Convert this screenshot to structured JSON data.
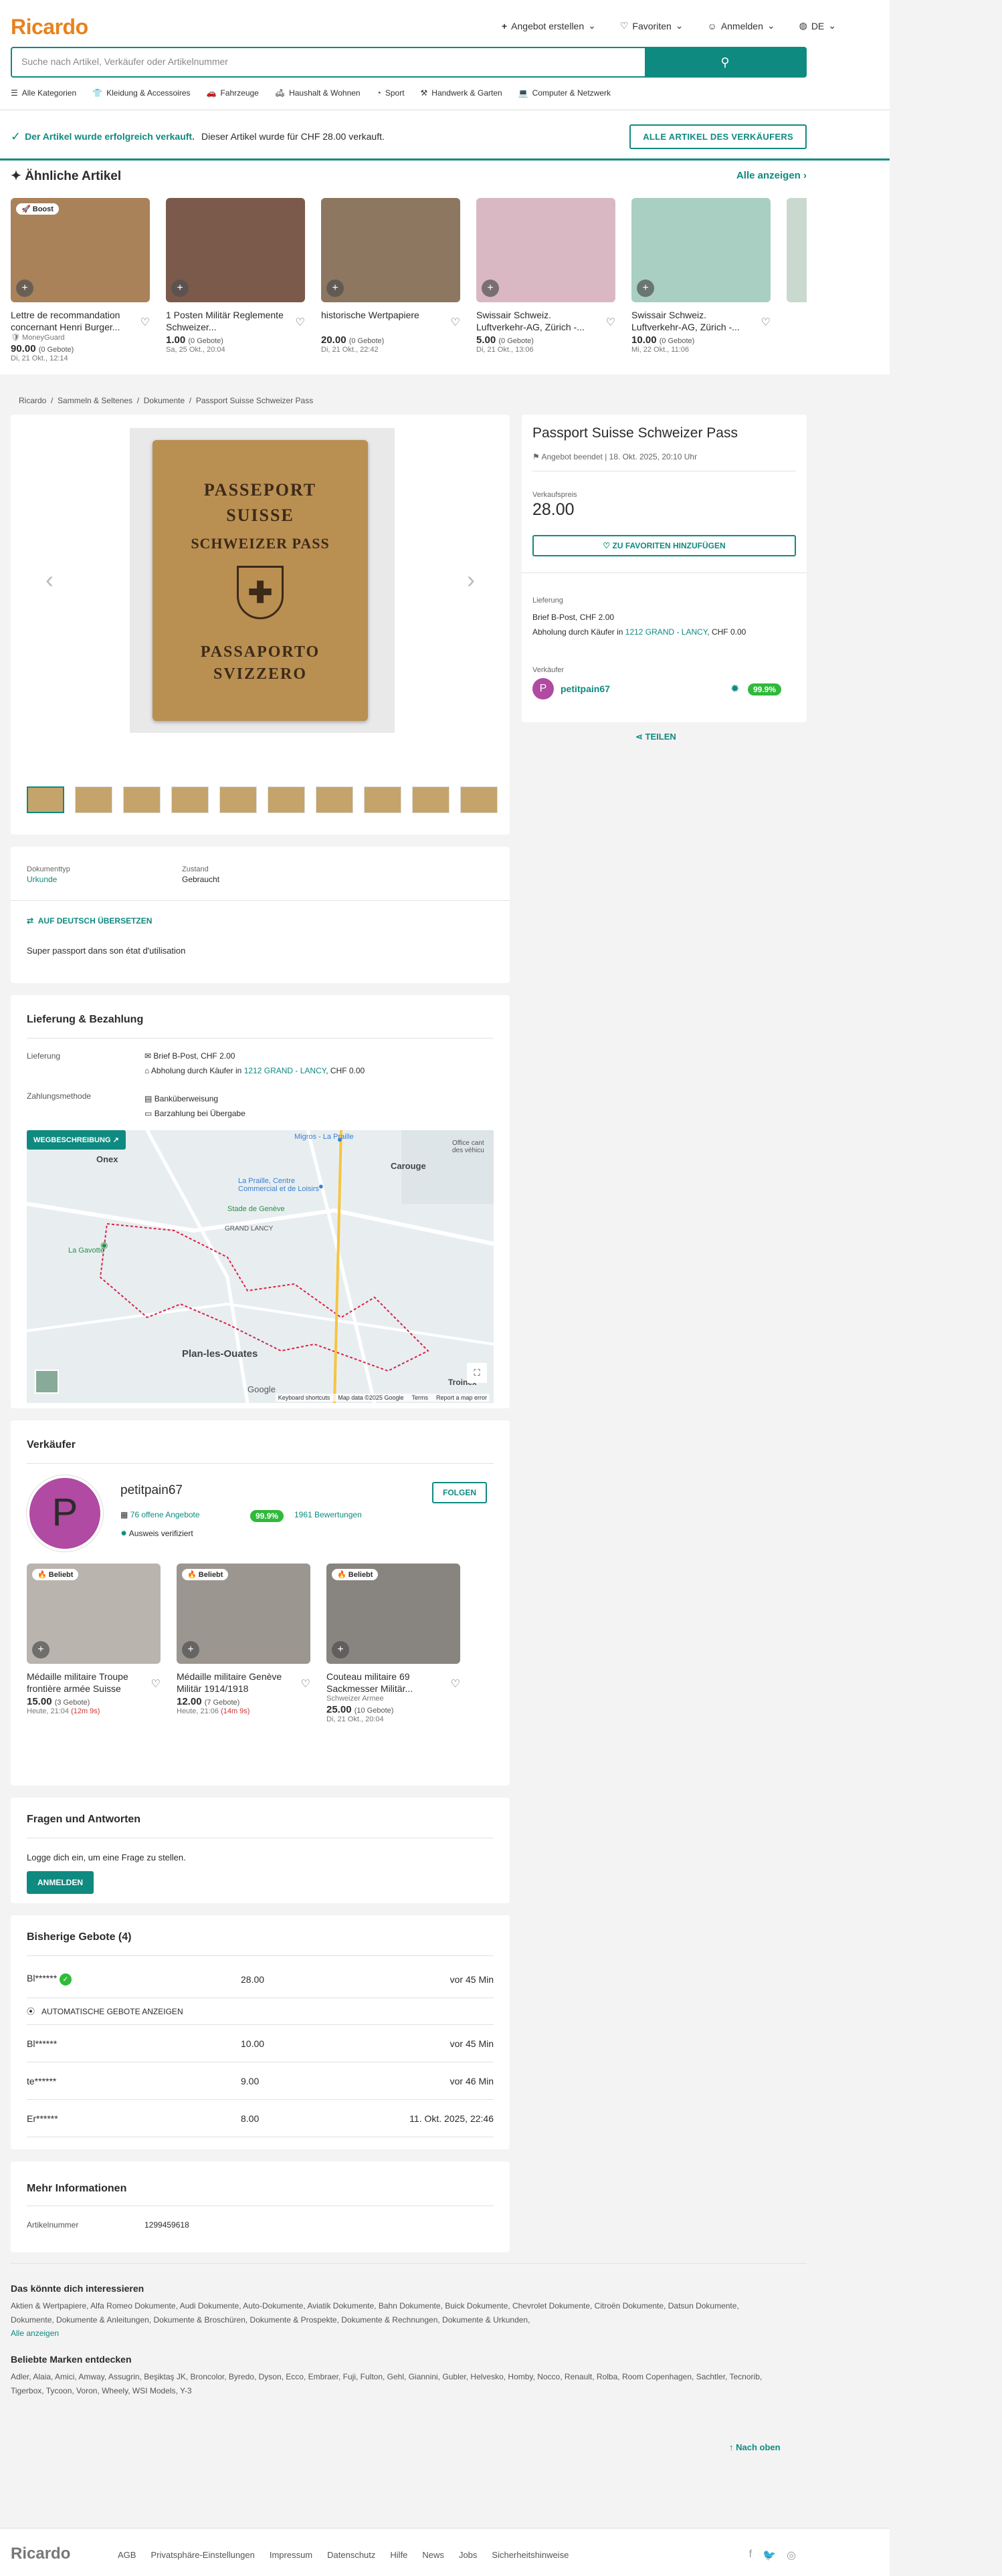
{
  "header": {
    "logo": "Ricardo",
    "nav": [
      "Angebot erstellen",
      "Favoriten",
      "Anmelden",
      "DE"
    ],
    "search_placeholder": "Suche nach Artikel, Verkäufer oder Artikelnummer",
    "categories": [
      "Alle Kategorien",
      "Kleidung & Accessoires",
      "Fahrzeuge",
      "Haushalt & Wohnen",
      "Sport",
      "Handwerk & Garten",
      "Computer & Netzwerk"
    ]
  },
  "sold_banner": {
    "title": "Der Artikel wurde erfolgreich verkauft.",
    "text": "Dieser Artikel wurde für CHF 28.00 verkauft.",
    "button": "ALLE ARTIKEL DES VERKÄUFERS"
  },
  "similar": {
    "title": "Ähnliche Artikel",
    "all_link": "Alle anzeigen",
    "items": [
      {
        "title": "Lettre de recommandation concernant Henri Burger...",
        "price": "90.00",
        "bids": "(0 Gebote)",
        "date": "Di, 21 Okt., 12:14",
        "sub": "MoneyGuard",
        "badge": "Boost",
        "color": "#a9825a"
      },
      {
        "title": "1 Posten Militär Reglemente Schweizer...",
        "price": "1.00",
        "bids": "(0 Gebote)",
        "date": "Sa, 25 Okt., 20:04",
        "sub": "",
        "badge": "",
        "color": "#7b5a4b"
      },
      {
        "title": "historische Wertpapiere",
        "price": "20.00",
        "bids": "(0 Gebote)",
        "date": "Di, 21 Okt., 22:42",
        "sub": "",
        "badge": "",
        "color": "#8d7760"
      },
      {
        "title": "Swissair Schweiz. Luftverkehr-AG, Zürich -...",
        "price": "5.00",
        "bids": "(0 Gebote)",
        "date": "Di, 21 Okt., 13:06",
        "sub": "",
        "badge": "",
        "color": "#d9b8c4"
      },
      {
        "title": "Swissair Schweiz. Luftverkehr-AG, Zürich -...",
        "price": "10.00",
        "bids": "(0 Gebote)",
        "date": "Mi, 22 Okt., 11:06",
        "sub": "",
        "badge": "",
        "color": "#a9cfc2"
      }
    ]
  },
  "breadcrumb": [
    "Ricardo",
    "Sammeln & Seltenes",
    "Dokumente",
    "Passport Suisse Schweizer Pass"
  ],
  "product": {
    "title": "Passport Suisse Schweizer Pass",
    "ended": "Angebot beendet |",
    "ended_date": "18. Okt. 2025, 20:10 Uhr",
    "price_label": "Verkaufspreis",
    "price": "28.00",
    "fav_button": "ZU FAVORITEN HINZUFÜGEN",
    "delivery_label": "Lieferung",
    "delivery1": "Brief B-Post, CHF 2.00",
    "delivery2_pre": "Abholung durch Käufer in",
    "delivery2_loc": "1212 GRAND - LANCY",
    "delivery2_post": ", CHF 0.00",
    "seller_label": "Verkäufer",
    "seller": "petitpain67",
    "rating": "99.9%",
    "share": "TEILEN",
    "passport_lines": [
      "PASSEPORT",
      "SUISSE",
      "SCHWEIZER PASS",
      "PASSAPORTO",
      "SVIZZERO"
    ]
  },
  "details": {
    "doc_label": "Dokumenttyp",
    "doc_value": "Urkunde",
    "state_label": "Zustand",
    "state_value": "Gebraucht",
    "translate": "AUF DEUTSCH ÜBERSETZEN",
    "description": "Super passport dans son état d'utilisation"
  },
  "shipping": {
    "title": "Lieferung & Bezahlung",
    "delivery_label": "Lieferung",
    "d1": "Brief B-Post, CHF 2.00",
    "d2_pre": "Abholung durch Käufer in",
    "d2_loc": "1212 GRAND - LANCY",
    "d2_post": ", CHF 0.00",
    "payment_label": "Zahlungsmethode",
    "p1": "Banküberweisung",
    "p2": "Barzahlung bei Übergabe",
    "map_button": "WEGBESCHREIBUNG",
    "map_labels": [
      "Onex",
      "Carouge",
      "La Praille, Centre Commercial et de Loisirs",
      "Stade de Genève",
      "GRAND LANCY",
      "Plan-les-Ouates",
      "La Gavotte",
      "Troinex",
      "Migros - La Praille",
      "Office cant des véhicu"
    ],
    "map_footer": [
      "Keyboard shortcuts",
      "Map data ©2025 Google",
      "Terms",
      "Report a map error"
    ],
    "google": "Google"
  },
  "seller": {
    "title": "Verkäufer",
    "name": "petitpain67",
    "follow": "FOLGEN",
    "offers": "76 offene Angebote",
    "rating": "99.9%",
    "reviews": "1961 Bewertungen",
    "verified": "Ausweis verifiziert",
    "initial": "P",
    "items": [
      {
        "title": "Médaille militaire Troupe frontière armée Suisse",
        "price": "15.00",
        "bids": "(3 Gebote)",
        "date": "Heute, 21:04",
        "left": "(12m 9s)",
        "sub": "",
        "badge": "Beliebt",
        "color": "#b9b5ae"
      },
      {
        "title": "Médaille militaire Genève Militär 1914/1918",
        "price": "12.00",
        "bids": "(7 Gebote)",
        "date": "Heute, 21:06",
        "left": "(14m 9s)",
        "sub": "",
        "badge": "Beliebt",
        "color": "#9b968f"
      },
      {
        "title": "Couteau militaire 69 Sackmesser Militär...",
        "price": "25.00",
        "bids": "(10 Gebote)",
        "date": "Di, 21 Okt., 20:04",
        "left": "",
        "sub": "Schweizer Armee",
        "badge": "Beliebt",
        "color": "#88847f"
      }
    ]
  },
  "qa": {
    "title": "Fragen und Antworten",
    "text": "Logge dich ein, um eine Frage zu stellen.",
    "button": "ANMELDEN"
  },
  "bids": {
    "title": "Bisherige Gebote (4)",
    "auto": "AUTOMATISCHE GEBOTE ANZEIGEN",
    "rows": [
      {
        "user": "Bl******",
        "amount": "28.00",
        "time": "vor 45 Min"
      },
      {
        "user": "Bl******",
        "amount": "10.00",
        "time": "vor 45 Min"
      },
      {
        "user": "te******",
        "amount": "9.00",
        "time": "vor 46 Min"
      },
      {
        "user": "Er******",
        "amount": "8.00",
        "time": "11. Okt. 2025, 22:46"
      }
    ]
  },
  "more": {
    "title": "Mehr Informationen",
    "label": "Artikelnummer",
    "value": "1299459618"
  },
  "interest": {
    "title": "Das könnte dich interessieren",
    "text": "Aktien & Wertpapiere, Alfa Romeo Dokumente, Audi Dokumente, Auto-Dokumente, Aviatik Dokumente, Bahn Dokumente, Buick Dokumente, Chevrolet Dokumente, Citroën Dokumente, Datsun Dokumente, Dokumente, Dokumente & Anleitungen, Dokumente & Broschüren, Dokumente & Prospekte, Dokumente & Rechnungen, Dokumente & Urkunden,",
    "link": "Alle anzeigen",
    "brands_title": "Beliebte Marken entdecken",
    "brands": "Adler, Alaia, Amici, Amway, Assugrin, Beşiktaş JK, Broncolor, Byredo, Dyson, Ecco, Embraer, Fuji, Fulton, Gehl, Giannini, Gubler, Helvesko, Homby, Nocco, Renault, Rolba, Room Copenhagen, Sachtler, Tecnorib, Tigerbox, Tycoon, Voron, Wheely, WSI Models, Y-3"
  },
  "top_link": "Nach oben",
  "footer": {
    "logo": "Ricardo",
    "links": [
      "AGB",
      "Privatsphäre-Einstellungen",
      "Impressum",
      "Datenschutz",
      "Hilfe",
      "News",
      "Jobs",
      "Sicherheitshinweise"
    ]
  },
  "colors": {
    "accent": "#0f8a80",
    "brand": "#e8821d",
    "rating": "#2fba3a",
    "avatar": "#b04aa2"
  }
}
